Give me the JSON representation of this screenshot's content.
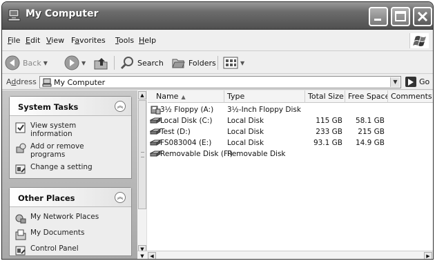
{
  "window": {
    "title": "My Computer",
    "controls": [
      "minimize",
      "maximize",
      "close"
    ]
  },
  "menubar": {
    "items": [
      {
        "label": "File",
        "accel": "F",
        "rest": "ile"
      },
      {
        "label": "Edit",
        "accel": "E",
        "rest": "dit"
      },
      {
        "label": "View",
        "accel": "V",
        "rest": "iew"
      },
      {
        "label": "Favorites",
        "accel": "a",
        "pre": "F",
        "rest": "vorites"
      },
      {
        "label": "Tools",
        "accel": "T",
        "rest": "ools"
      },
      {
        "label": "Help",
        "accel": "H",
        "rest": "elp"
      }
    ]
  },
  "toolbar": {
    "back_label": "Back",
    "search_label": "Search",
    "folders_label": "Folders"
  },
  "address": {
    "label_accel": "d",
    "label_pre": "A",
    "label_rest": "dress",
    "value": "My Computer",
    "go_label": "Go"
  },
  "tasks": {
    "system": {
      "title": "System Tasks",
      "items": [
        {
          "line1": "View system",
          "line2": "information",
          "icon": "info-icon"
        },
        {
          "line1": "Add or remove",
          "line2": "programs",
          "icon": "add-remove-icon"
        },
        {
          "line1": "Change a setting",
          "line2": "",
          "icon": "control-panel-icon"
        }
      ]
    },
    "places": {
      "title": "Other Places",
      "items": [
        {
          "line1": "My Network Places",
          "icon": "network-icon"
        },
        {
          "line1": "My Documents",
          "icon": "documents-icon"
        },
        {
          "line1": "Control Panel",
          "icon": "control-panel-icon"
        }
      ]
    }
  },
  "columns": [
    "Name",
    "Type",
    "Total Size",
    "Free Space",
    "Comments"
  ],
  "drives": [
    {
      "name": "3½ Floppy (A:)",
      "type": "3½-Inch Floppy Disk",
      "total": "",
      "free": "",
      "icon": "floppy-icon"
    },
    {
      "name": "Local Disk (C:)",
      "type": "Local Disk",
      "total": "115 GB",
      "free": "58.1 GB",
      "icon": "disk-icon"
    },
    {
      "name": "Test (D:)",
      "type": "Local Disk",
      "total": "233 GB",
      "free": "215 GB",
      "icon": "disk-icon"
    },
    {
      "name": "FS083004 (E:)",
      "type": "Local Disk",
      "total": "93.1 GB",
      "free": "14.9 GB",
      "icon": "disk-icon"
    },
    {
      "name": "Removable Disk (F:)",
      "type": "Removable Disk",
      "total": "",
      "free": "",
      "icon": "removable-icon"
    }
  ]
}
